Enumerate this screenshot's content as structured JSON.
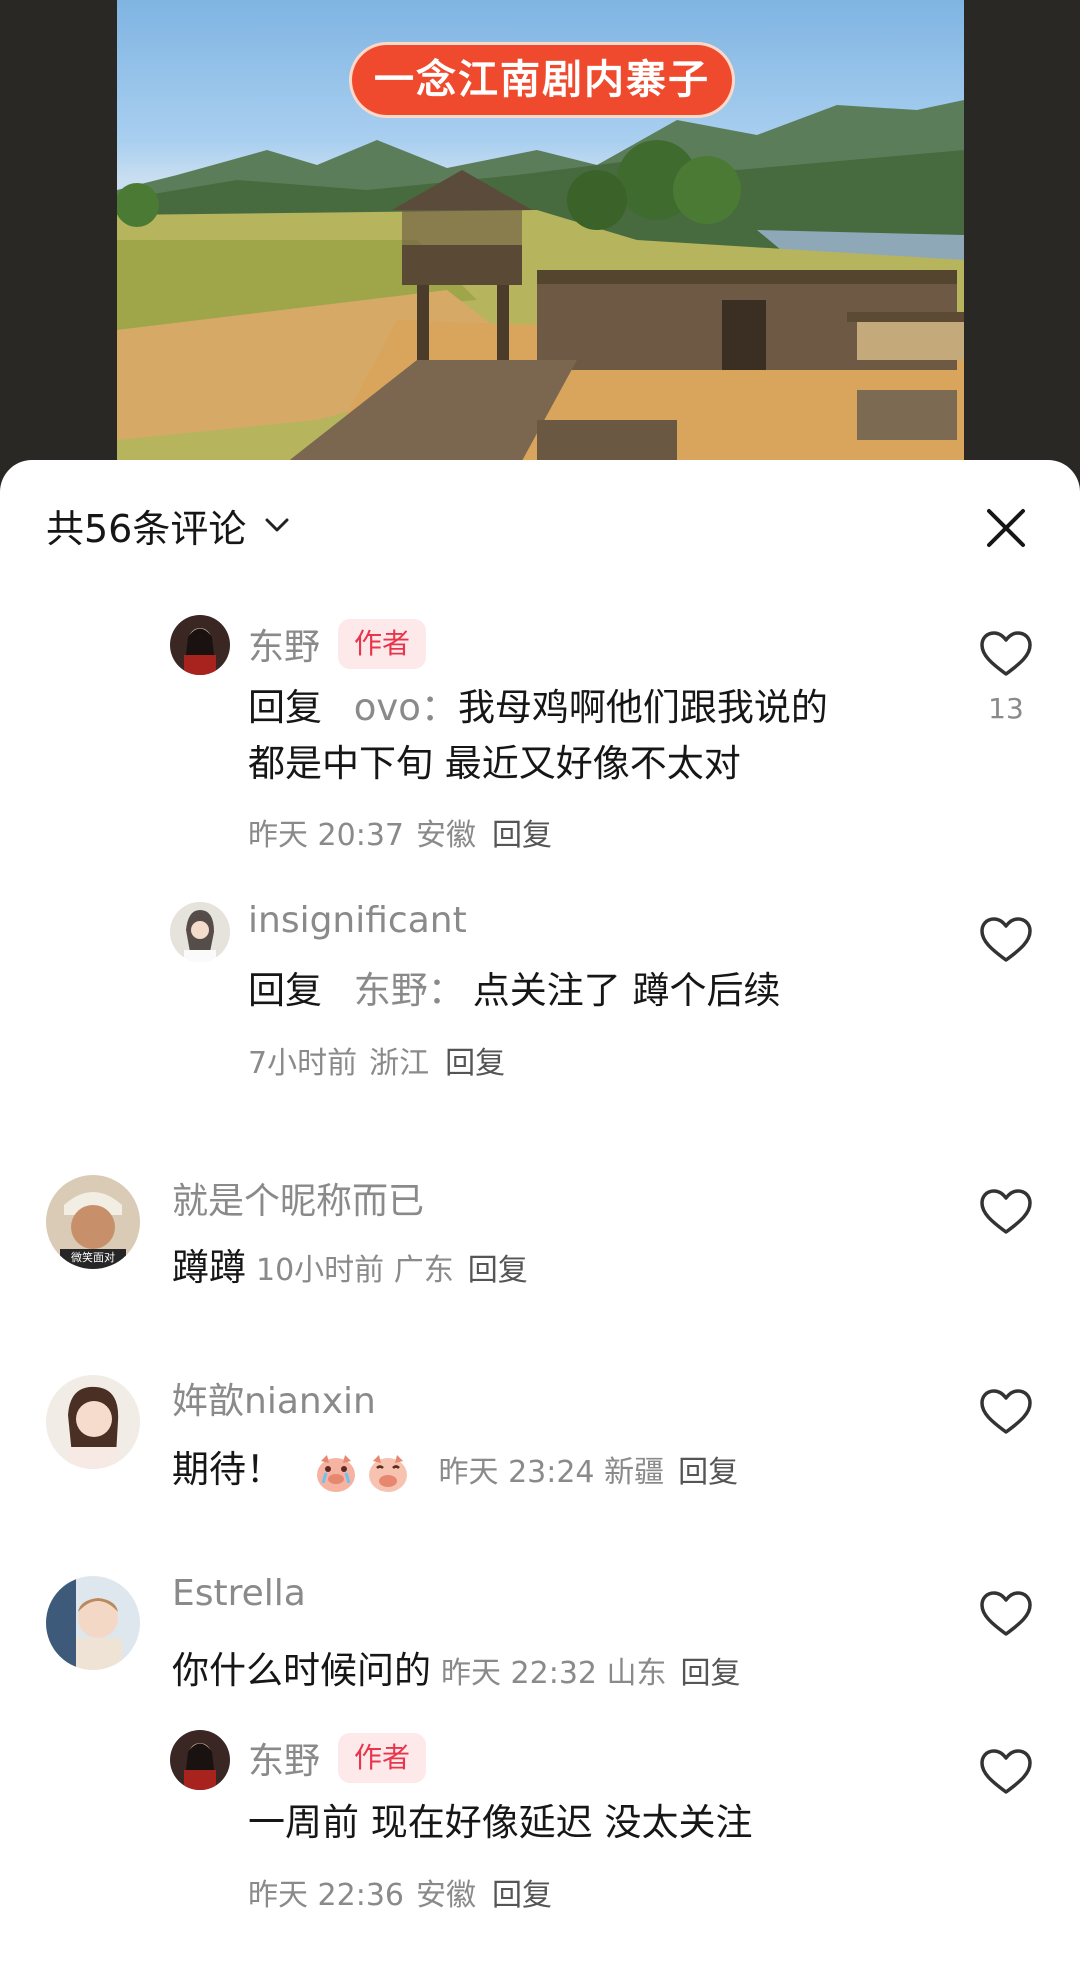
{
  "video": {
    "title": "一念江南剧内寨子"
  },
  "sheet": {
    "count_label": "共56条评论"
  },
  "comments": [
    {
      "username": "东野",
      "badge": "作者",
      "reply_prefix": "回复",
      "reply_target": "ovo：",
      "text_line1": "我母鸡啊他们跟我说的",
      "text_line2": "都是中下旬 最近又好像不太对",
      "time": "昨天 20:37",
      "location": "安徽",
      "reply_label": "回复",
      "like_count": "13"
    },
    {
      "username": "insignificant",
      "reply_prefix": "回复",
      "reply_target": "东野：",
      "text": "点关注了 蹲个后续",
      "time": "7小时前",
      "location": "浙江",
      "reply_label": "回复"
    },
    {
      "username": "就是个昵称而已",
      "avatar_caption": "微笑面对",
      "text": "蹲蹲",
      "time": "10小时前",
      "location": "广东",
      "reply_label": "回复"
    },
    {
      "username": "姩歆nianxin",
      "text": "期待！",
      "emojis": [
        "pig-crying-icon",
        "pig-pouting-icon"
      ],
      "time": "昨天 23:24",
      "location": "新疆",
      "reply_label": "回复"
    },
    {
      "username": "Estrella",
      "text": "你什么时候问的",
      "time": "昨天 22:32",
      "location": "山东",
      "reply_label": "回复"
    },
    {
      "username": "东野",
      "badge": "作者",
      "text": "一周前 现在好像延迟  没太关注",
      "time": "昨天 22:36",
      "location": "安徽",
      "reply_label": "回复"
    }
  ],
  "colors": {
    "author_badge_bg": "#fde8ea",
    "author_badge_text": "#e9354b",
    "title_pill": "#f04a2e",
    "secondary_text": "#8a8a8a"
  }
}
